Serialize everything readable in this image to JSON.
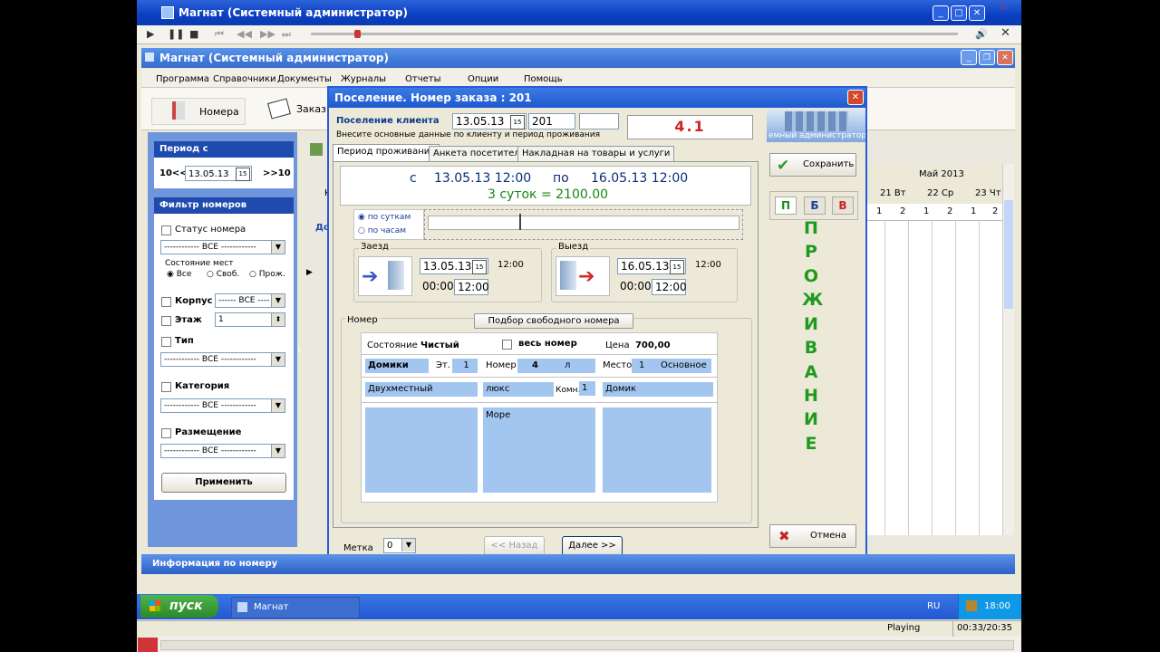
{
  "player": {
    "title": "Магнат  (Системный администратор)",
    "status": "Playing",
    "time": "00:33/20:35"
  },
  "app": {
    "title": "Магнат  (Системный администратор)"
  },
  "menu": [
    "Программа",
    "Справочники",
    "Документы",
    "Журналы",
    "Отчеты",
    "Опции",
    "Помощь"
  ],
  "toolbar": {
    "rooms": "Номера",
    "orders": "Заказы"
  },
  "left": {
    "period_header": "Период с",
    "prev": "10<<",
    "date": "13.05.13",
    "next": ">>10",
    "filter_header": "Фильтр номеров",
    "status_label": "Статус номера",
    "all": "------------ ВСЕ ------------",
    "seats_label": "Состояние мест",
    "opt_all": "Все",
    "opt_free": "Своб.",
    "opt_other": "Прож.",
    "korpus": "Корпус",
    "korpus_val": "------ ВСЕ ----",
    "floor": "Этаж",
    "floor_val": "1",
    "type": "Тип",
    "category": "Категория",
    "placement": "Размещение",
    "apply": "Применить"
  },
  "grid": {
    "month": "Май 2013",
    "days": [
      "21 Вт",
      "22 Ср",
      "23 Чт"
    ],
    "slots": [
      "1",
      "2",
      "1",
      "2",
      "1",
      "2"
    ],
    "col_k": "К",
    "col_do": "До"
  },
  "dialog": {
    "title": "Поселение. Номер заказа : 201",
    "client_label": "Поселение клиента",
    "date": "13.05.13",
    "order": "201",
    "code": "4.1",
    "hint": "Внесите основные данные  по клиенту и период проживания",
    "corner_text": "емный администратор",
    "tabs": [
      "Период проживания",
      "Анкета посетителя",
      "Накладная на товары и услуги"
    ],
    "from_label": "с",
    "from": "13.05.13 12:00",
    "to_label": "по",
    "to": "16.05.13 12:00",
    "summary": "3 суток = 2100.00",
    "by_days": "по суткам",
    "by_hours": "по часам",
    "checkin": {
      "label": "Заезд",
      "date": "13.05.13",
      "time1": "00:00",
      "time2": "12:00",
      "default": "12:00"
    },
    "checkout": {
      "label": "Выезд",
      "date": "16.05.13",
      "time1": "00:00",
      "time2": "12:00",
      "default": "12:00"
    },
    "room_label": "Номер",
    "pick_btn": "Подбор свободного номера",
    "state_label": "Состояние",
    "state_val": "Чистый",
    "whole_room": "весь номер",
    "price_label": "Цена",
    "price_val": "700,00",
    "building": "Домики",
    "floor_label": "Эт.",
    "floor_val": "1",
    "room_no_label": "Номер",
    "room_no": "4",
    "room_suffix": "л",
    "place_label": "Место",
    "place_val": "1",
    "place_type": "Основное",
    "room_type": "Двухместный",
    "room_class": "люкс",
    "rooms_label": "Комн.",
    "rooms_val": "1",
    "room_kind": "Домик",
    "view": "Море",
    "mark_label": "Метка",
    "mark_val": "0",
    "back": "<< Назад",
    "next": "Далее >>",
    "save": "Сохранить",
    "cancel": "Отмена",
    "mode_p": "П",
    "mode_b": "Б",
    "mode_v": "В",
    "vertical": [
      "П",
      "Р",
      "О",
      "Ж",
      "И",
      "В",
      "А",
      "Н",
      "И",
      "Е"
    ]
  },
  "info_bar": "Информация по номеру",
  "taskbar": {
    "start": "пуск",
    "task": "Магнат",
    "lang": "RU",
    "clock": "18:00"
  }
}
